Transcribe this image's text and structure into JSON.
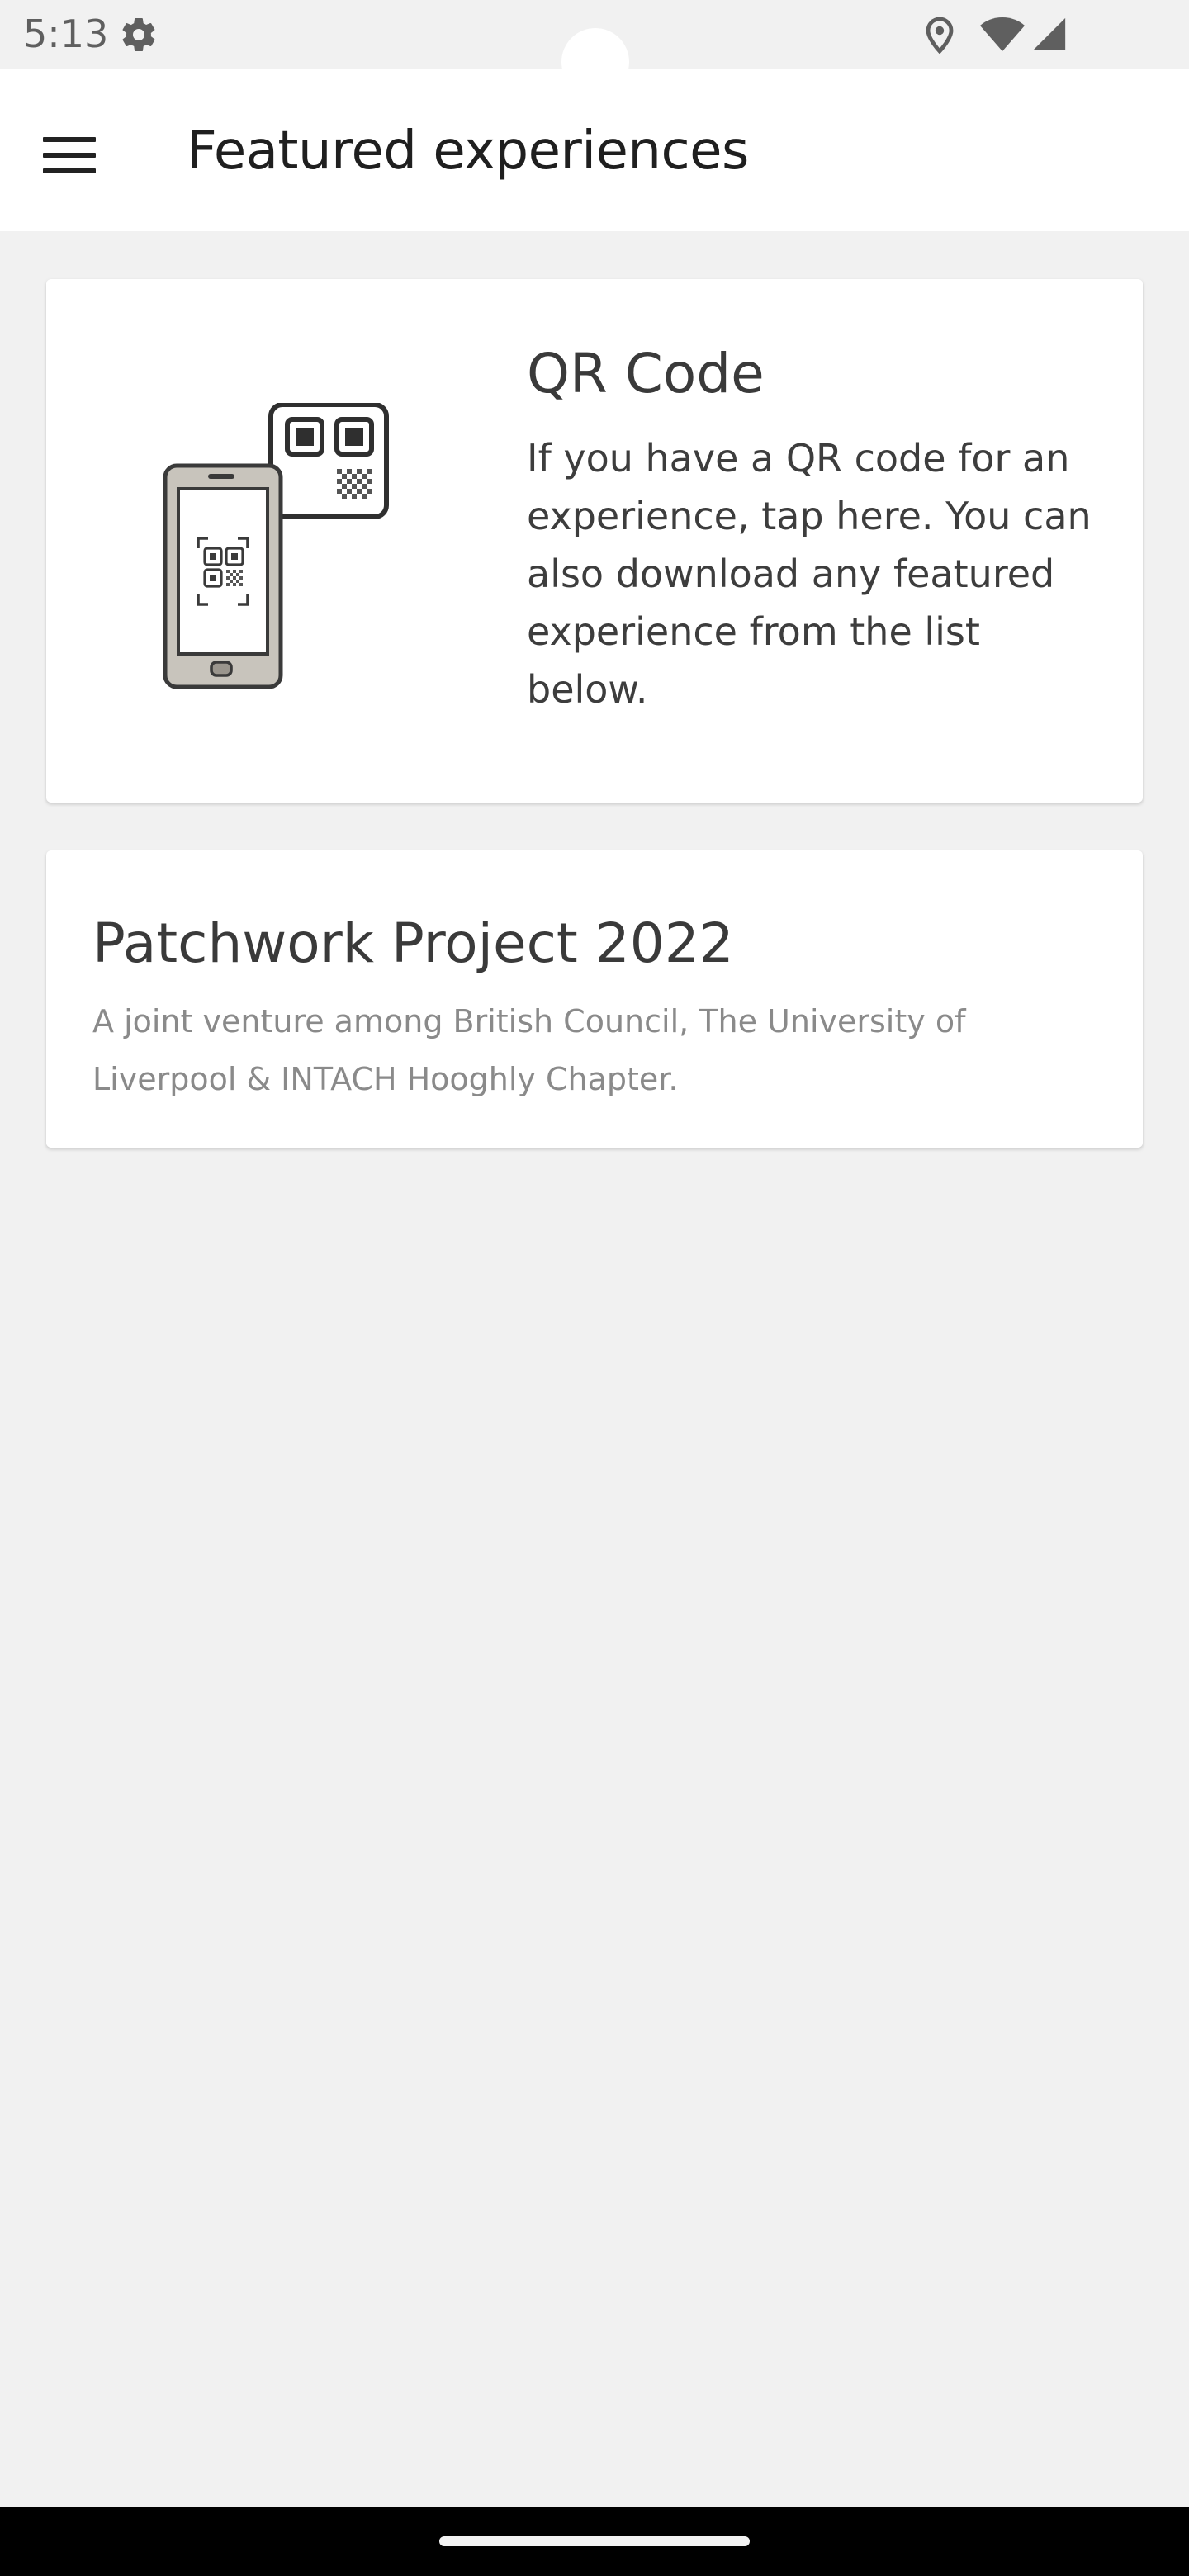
{
  "status_bar": {
    "time": "5:13",
    "icons": [
      "gear-icon",
      "location-icon",
      "wifi-icon",
      "cell-signal-icon"
    ]
  },
  "app_bar": {
    "menu_icon": "menu-icon",
    "title": "Featured experiences"
  },
  "qr_card": {
    "illustration": "phone-qr-scan-icon",
    "title": "QR Code",
    "description": "If you have a QR code for an experience, tap here. You can also download any featured experience from the list below."
  },
  "experiences": [
    {
      "title": "Patchwork Project 2022",
      "description": "A joint venture among British Council, The University of Liverpool & INTACH Hooghly Chapter."
    }
  ],
  "colors": {
    "background": "#f1f1f1",
    "card": "#ffffff",
    "title_text": "#1f1f1f",
    "body_text": "#3d3d3d",
    "secondary_text": "#8a8a8a"
  }
}
